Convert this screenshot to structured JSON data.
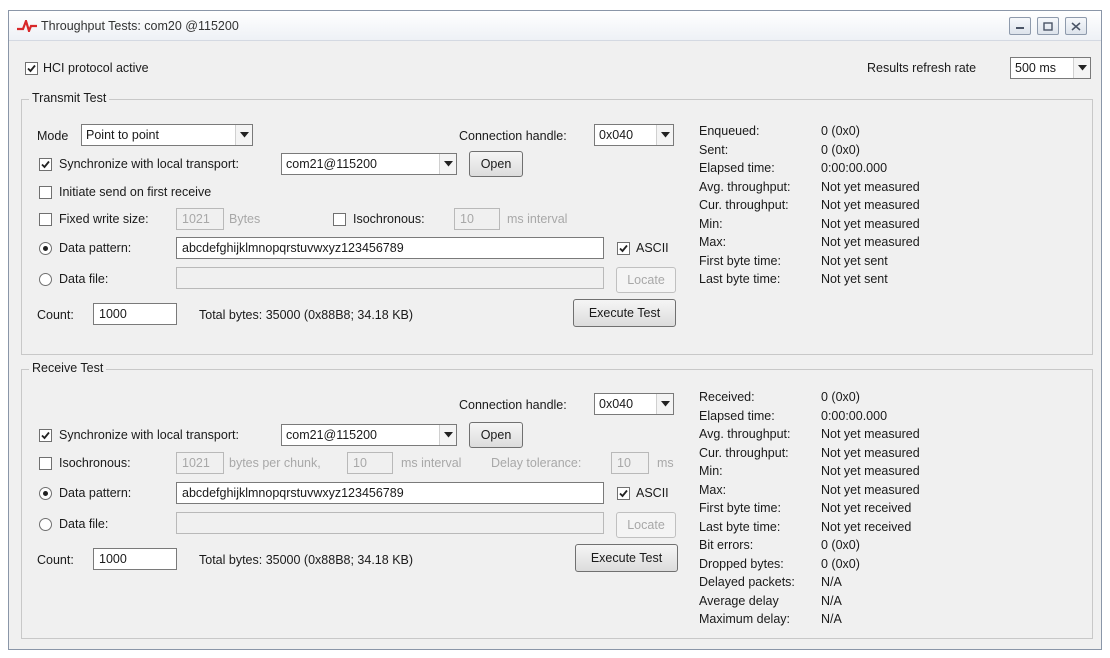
{
  "window": {
    "title": "Throughput Tests: com20 @115200"
  },
  "top": {
    "hci_label": "HCI protocol active",
    "hci_checked": true,
    "refresh_label": "Results refresh rate",
    "refresh_value": "500 ms"
  },
  "transmit": {
    "group_title": "Transmit Test",
    "mode_label": "Mode",
    "mode_value": "Point to point",
    "conn_label": "Connection handle:",
    "conn_value": "0x040",
    "sync_label": "Synchronize with local transport:",
    "sync_checked": true,
    "transport_value": "com21@115200",
    "open_label": "Open",
    "initiate_label": "Initiate send on first receive",
    "fixed_label": "Fixed write size:",
    "fixed_value": "1021",
    "fixed_unit": "Bytes",
    "iso_label": "Isochronous:",
    "iso_value": "10",
    "iso_unit": "ms interval",
    "pattern_label": "Data pattern:",
    "pattern_value": "abcdefghijklmnopqrstuvwxyz123456789",
    "ascii_label": "ASCII",
    "file_label": "Data file:",
    "locate_label": "Locate",
    "count_label": "Count:",
    "count_value": "1000",
    "total_bytes": "Total bytes: 35000 (0x88B8; 34.18 KB)",
    "execute_label": "Execute Test",
    "stats": [
      {
        "name": "Enqueued:",
        "value": "0 (0x0)"
      },
      {
        "name": "Sent:",
        "value": "0 (0x0)"
      },
      {
        "name": "Elapsed time:",
        "value": "0:00:00.000"
      },
      {
        "name": "Avg. throughput:",
        "value": "Not yet measured"
      },
      {
        "name": "Cur. throughput:",
        "value": "Not yet measured"
      },
      {
        "name": "Min:",
        "value": "Not yet measured"
      },
      {
        "name": "Max:",
        "value": "Not yet measured"
      },
      {
        "name": "First byte time:",
        "value": "Not yet sent"
      },
      {
        "name": "Last byte time:",
        "value": "Not yet sent"
      }
    ]
  },
  "receive": {
    "group_title": "Receive Test",
    "conn_label": "Connection handle:",
    "conn_value": "0x040",
    "sync_label": "Synchronize with local transport:",
    "sync_checked": true,
    "transport_value": "com21@115200",
    "open_label": "Open",
    "iso_label": "Isochronous:",
    "chunk_value": "1021",
    "chunk_unit": "bytes per chunk,",
    "interval_value": "10",
    "interval_unit": "ms interval",
    "delay_label": "Delay tolerance:",
    "delay_value": "10",
    "delay_unit": "ms",
    "pattern_label": "Data pattern:",
    "pattern_value": "abcdefghijklmnopqrstuvwxyz123456789",
    "ascii_label": "ASCII",
    "file_label": "Data file:",
    "locate_label": "Locate",
    "count_label": "Count:",
    "count_value": "1000",
    "total_bytes": "Total bytes: 35000 (0x88B8; 34.18 KB)",
    "execute_label": "Execute Test",
    "stats": [
      {
        "name": "Received:",
        "value": "0 (0x0)"
      },
      {
        "name": "Elapsed time:",
        "value": "0:00:00.000"
      },
      {
        "name": "Avg. throughput:",
        "value": "Not yet measured"
      },
      {
        "name": "Cur. throughput:",
        "value": "Not yet measured"
      },
      {
        "name": "Min:",
        "value": "Not yet measured"
      },
      {
        "name": "Max:",
        "value": "Not yet measured"
      },
      {
        "name": "First byte time:",
        "value": "Not yet received"
      },
      {
        "name": "Last byte time:",
        "value": "Not yet received"
      },
      {
        "name": "Bit errors:",
        "value": "0 (0x0)"
      },
      {
        "name": "Dropped bytes:",
        "value": "0 (0x0)"
      },
      {
        "name": "Delayed packets:",
        "value": "N/A"
      },
      {
        "name": "Average delay",
        "value": "N/A"
      },
      {
        "name": "Maximum delay:",
        "value": "N/A"
      }
    ]
  },
  "icons": {
    "app": "waveform-icon",
    "minimize": "minimize-icon",
    "maximize": "maximize-icon",
    "close": "close-icon",
    "checkmark": "checkmark-icon",
    "dropdown": "chevron-down-icon"
  },
  "colors": {
    "app_icon": "#d8282a",
    "window_bg": "#f0f0f0"
  }
}
